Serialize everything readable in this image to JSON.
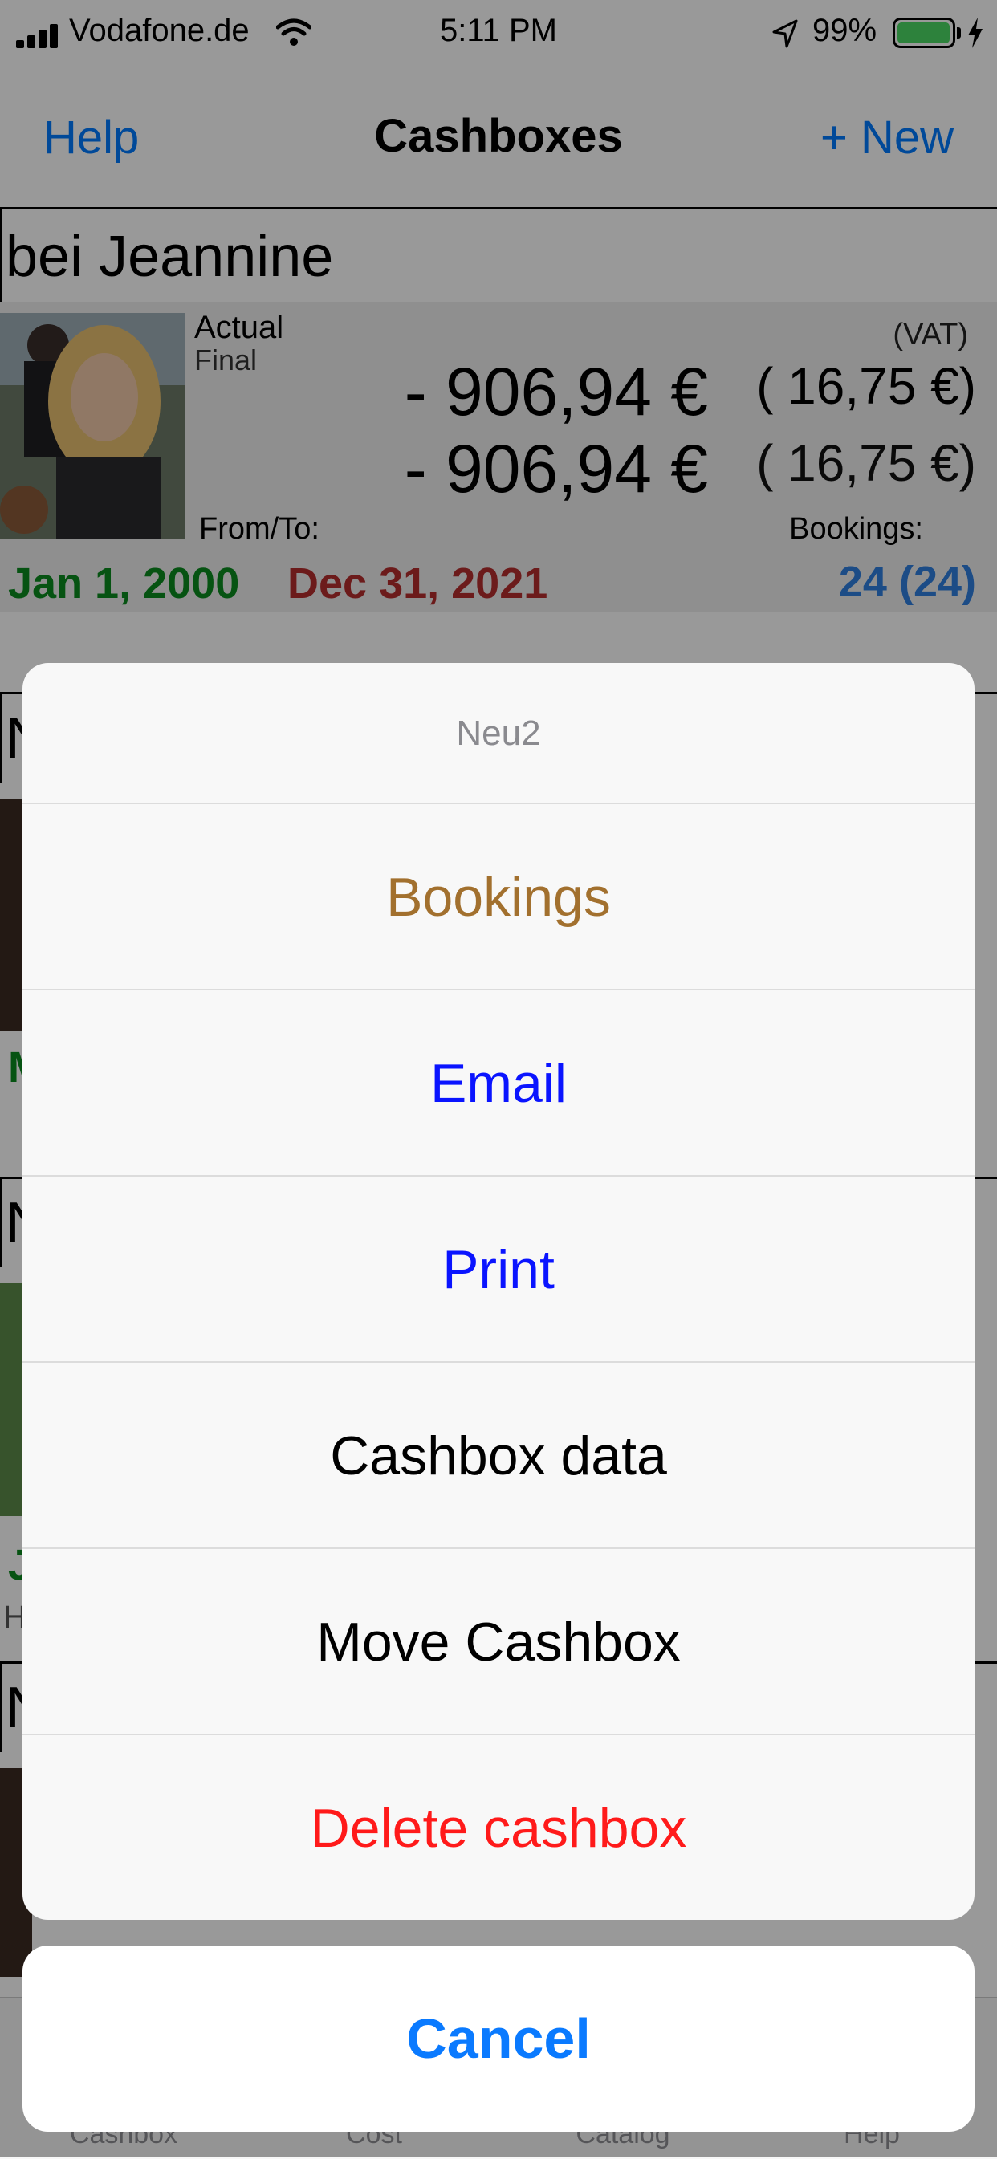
{
  "status_bar": {
    "carrier": "Vodafone.de",
    "time": "5:11 PM",
    "battery_percent": "99%",
    "battery_level": 0.99,
    "battery_color": "#4cd964"
  },
  "nav": {
    "left_button": "Help",
    "title": "Cashboxes",
    "right_button": "+ New"
  },
  "cashbox": {
    "name": "bei Jeannine",
    "label_actual": "Actual",
    "label_final": "Final",
    "label_vat": "(VAT)",
    "amount_actual": "- 906,94 €",
    "amount_final": "- 906,94 €",
    "vat_actual": "( 16,75 €)",
    "vat_final": "( 16,75 €)",
    "label_from_to": "From/To:",
    "label_bookings": "Bookings:",
    "date_from": "Jan 1, 2000",
    "date_to": "Dec 31, 2021",
    "bookings_count": "24 (24)"
  },
  "background_rows": {
    "row2_initial": "N",
    "row2_date_initial": "M",
    "row3_initial": "N",
    "row3_date_initial": "J",
    "row3_extra_initial": "H",
    "row4_initial": "N"
  },
  "tab_bar": {
    "tabs": [
      "Cashbox",
      "Cost",
      "Catalog",
      "Help"
    ]
  },
  "action_sheet": {
    "title": "Neu2",
    "actions": [
      {
        "label": "Bookings",
        "color": "#a2702e"
      },
      {
        "label": "Email",
        "color": "#0a14ff"
      },
      {
        "label": "Print",
        "color": "#0a14ff"
      },
      {
        "label": "Cashbox data",
        "color": "#000000"
      },
      {
        "label": "Move Cashbox",
        "color": "#000000"
      },
      {
        "label": "Delete cashbox",
        "color": "#ff1a1a"
      }
    ],
    "cancel": "Cancel"
  }
}
